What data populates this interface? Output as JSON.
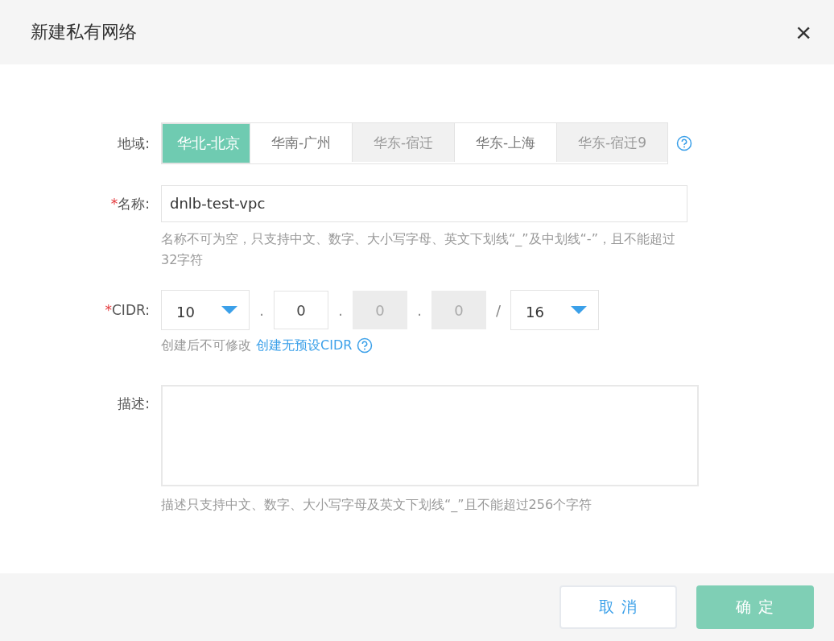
{
  "dialog": {
    "title": "新建私有网络",
    "close": "×"
  },
  "region": {
    "label": "地域:",
    "regions": [
      {
        "label": "华北-北京",
        "selected": true,
        "disabled": false
      },
      {
        "label": "华南-广州",
        "selected": false,
        "disabled": false
      },
      {
        "label": "华东-宿迁",
        "selected": false,
        "disabled": true
      },
      {
        "label": "华东-上海",
        "selected": false,
        "disabled": false
      },
      {
        "label": "华东-宿迁9",
        "selected": false,
        "disabled": true
      }
    ]
  },
  "name": {
    "required_mark": "*",
    "label": "名称:",
    "value": "dnlb-test-vpc",
    "hint": "名称不可为空，只支持中文、数字、大小写字母、英文下划线“_”及中划线“-”，且不能超过32字符"
  },
  "cidr": {
    "required_mark": "*",
    "label": "CIDR:",
    "parts": [
      {
        "kind": "select",
        "value": "10",
        "disabled": false
      },
      {
        "kind": "separator",
        "value": "."
      },
      {
        "kind": "input",
        "value": "0",
        "disabled": false
      },
      {
        "kind": "separator",
        "value": "."
      },
      {
        "kind": "input",
        "value": "0",
        "disabled": true
      },
      {
        "kind": "separator",
        "value": "."
      },
      {
        "kind": "input",
        "value": "0",
        "disabled": true
      },
      {
        "kind": "separator",
        "value": "/"
      },
      {
        "kind": "select",
        "value": "16",
        "disabled": false
      }
    ],
    "hint": "创建后不可修改",
    "link": "创建无预设CIDR"
  },
  "description": {
    "label": "描述:",
    "hint": "描述只支持中文、数字、大小写字母及英文下划线“_”且不能超过256个字符"
  },
  "buttons": [
    {
      "label": "取 消",
      "kind": "secondary"
    },
    {
      "label": "确 定",
      "kind": "primary"
    }
  ]
}
